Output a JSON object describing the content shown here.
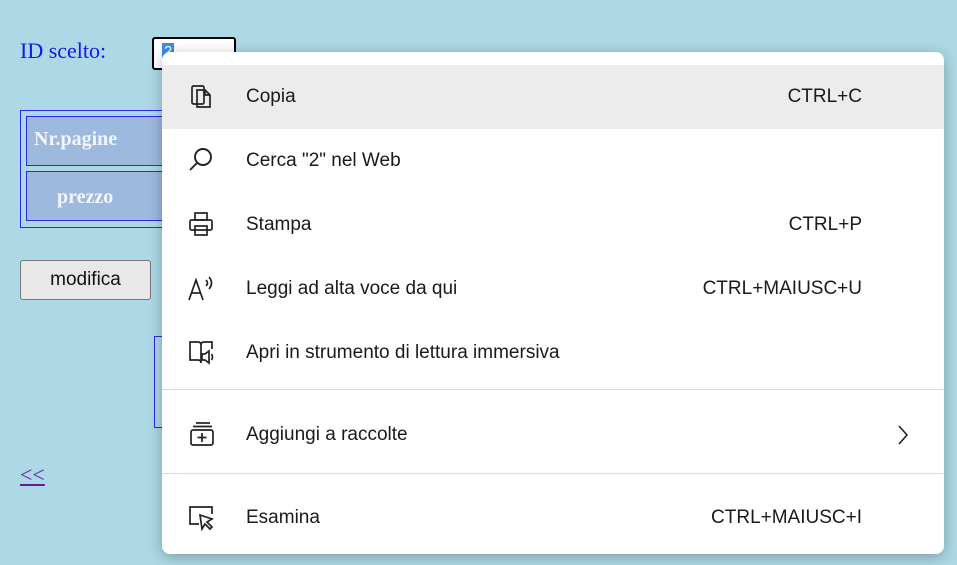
{
  "page": {
    "id_label": "ID scelto:",
    "id_value": "2",
    "form": {
      "field1_label": "Nr.pagine",
      "field2_label": "prezzo"
    },
    "modifica_label": "modifica",
    "back_link": "<<"
  },
  "context_menu": {
    "items": [
      {
        "label": "Copia",
        "shortcut": "CTRL+C",
        "icon": "copy-icon"
      },
      {
        "label": "Cerca \"2\" nel Web",
        "shortcut": "",
        "icon": "search-icon"
      },
      {
        "label": "Stampa",
        "shortcut": "CTRL+P",
        "icon": "print-icon"
      },
      {
        "label": "Leggi ad alta voce da qui",
        "shortcut": "CTRL+MAIUSC+U",
        "icon": "read-aloud-icon"
      },
      {
        "label": "Apri in strumento di lettura immersiva",
        "shortcut": "",
        "icon": "immersive-reader-icon"
      },
      {
        "label": "Aggiungi a raccolte",
        "shortcut": "",
        "icon": "collections-icon",
        "submenu": true
      },
      {
        "label": "Esamina",
        "shortcut": "CTRL+MAIUSC+I",
        "icon": "inspect-icon"
      }
    ]
  },
  "colors": {
    "background": "#add8e6",
    "text_blue": "#1515ee",
    "menu_highlight": "#ececec"
  }
}
